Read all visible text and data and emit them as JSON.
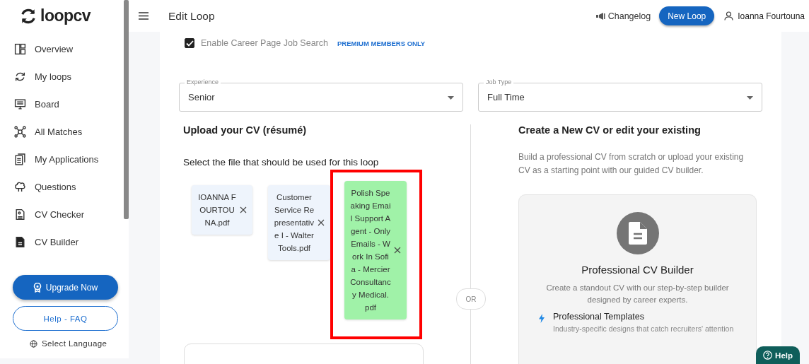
{
  "sidebar": {
    "logo": "loopcv",
    "items": [
      {
        "label": "Overview"
      },
      {
        "label": "My loops"
      },
      {
        "label": "Board"
      },
      {
        "label": "All Matches"
      },
      {
        "label": "My Applications"
      },
      {
        "label": "Questions"
      },
      {
        "label": "CV Checker"
      },
      {
        "label": "CV Builder"
      }
    ],
    "upgrade_button": "Upgrade Now",
    "help_button": "Help - FAQ",
    "language": "Select Language"
  },
  "topbar": {
    "title": "Edit Loop",
    "changelog": "Changelog",
    "new_loop_button": "New Loop",
    "user": "Ioanna Fourtouna"
  },
  "career_search": {
    "label": "Enable Career Page Job Search",
    "checked": true,
    "badge": "PREMIUM MEMBERS ONLY"
  },
  "selects": [
    {
      "label": "Experience",
      "value": "Senior"
    },
    {
      "label": "Job Type",
      "value": "Full Time"
    }
  ],
  "upload": {
    "title": "Upload your CV (résumé)",
    "subtitle": "Select the file that should be used for this loop",
    "files": [
      {
        "name": "IOANNA FOURTOUNA.pdf",
        "selected": false
      },
      {
        "name": "Customer Service Representative I - Walter Tools.pdf",
        "selected": false
      },
      {
        "name": "Polish Speaking Email Support Agent - Only Emails - Work In Sofia - Mercier Consultancy Medical.pdf",
        "selected": true
      }
    ]
  },
  "divider_label": "OR",
  "builder": {
    "title": "Create a New CV or edit your existing",
    "description": "Build a professional CV from scratch or upload your existing CV as a starting point with our guided CV builder.",
    "card_title": "Professional CV Builder",
    "card_description": "Create a standout CV with our step-by-step builder designed by career experts.",
    "features": [
      {
        "title": "Professional Templates",
        "description": "Industry-specific designs that catch recruiters' attention"
      }
    ]
  },
  "help_widget": "Help"
}
